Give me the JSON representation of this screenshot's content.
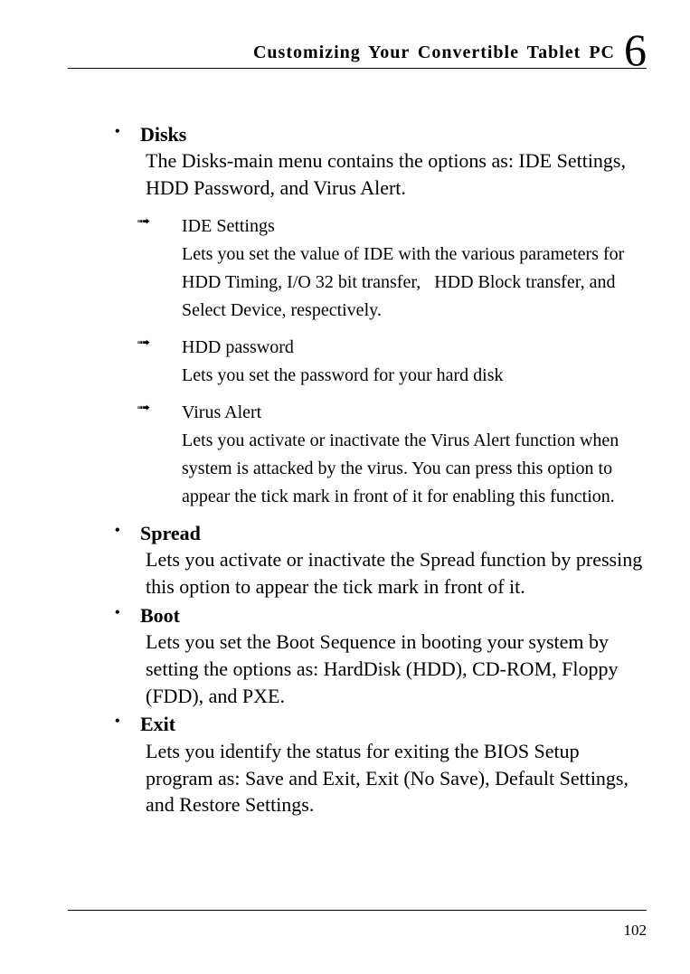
{
  "header": {
    "title": "Customizing Your Convertible Tablet PC",
    "chapter": "6"
  },
  "sections": [
    {
      "title": "Disks",
      "body": "The Disks-main menu contains the options as: IDE Settings, HDD Password, and Virus Alert.",
      "sub": [
        {
          "title": "IDE Settings",
          "body": "Lets you set the value of IDE with the various parameters for HDD Timing, I/O 32 bit transfer,  HDD Block transfer, and Select Device, respectively."
        },
        {
          "title": "HDD password",
          "body": "Lets you set the password for your hard disk"
        },
        {
          "title": "Virus Alert",
          "body": "Lets you activate or inactivate the Virus Alert function when system is attacked by the virus. You can press this option to appear the tick mark in front of it for enabling this function."
        }
      ]
    },
    {
      "title": "Spread",
      "body": "Lets you activate or inactivate the Spread function by pressing this option to appear the tick mark in front of it."
    },
    {
      "title": "Boot",
      "body": "Lets you set the Boot Sequence in booting your system by setting the options as: HardDisk (HDD), CD-ROM, Floppy (FDD), and PXE."
    },
    {
      "title": "Exit",
      "body": "Lets you identify the status for exiting the BIOS Setup program as: Save and Exit, Exit (No Save), Default Settings, and Restore Settings."
    }
  ],
  "page_number": "102"
}
